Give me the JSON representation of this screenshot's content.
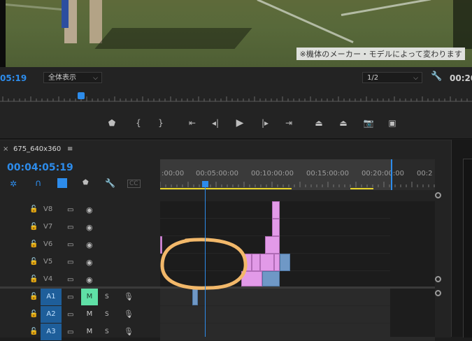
{
  "program_monitor": {
    "watermark": "※機体のメーカー・モデルによって変わります",
    "timecode_left": "05:19",
    "fit_select": "全体表示",
    "resolution_select": "1/2",
    "timecode_right": "00:20"
  },
  "transport": {
    "buttons": [
      "add-marker-icon",
      "mark-in-icon",
      "mark-out-icon",
      "go-to-in-icon",
      "step-back-icon",
      "play-icon",
      "step-forward-icon",
      "go-to-out-icon",
      "lift-icon",
      "extract-icon",
      "export-frame-icon",
      "comparison-view-icon"
    ]
  },
  "timeline": {
    "tab_label": "675_640x360",
    "tab_menu": "≡",
    "close": "×",
    "timecode": "00:04:05:19",
    "ruler_labels": [
      ":00:00",
      "00:05:00:00",
      "00:10:00:00",
      "00:15:00:00",
      "00:20:00:00",
      "00:2"
    ],
    "video_tracks": [
      {
        "name": "V8"
      },
      {
        "name": "V7"
      },
      {
        "name": "V6"
      },
      {
        "name": "V5"
      },
      {
        "name": "V4"
      }
    ],
    "audio_tracks": [
      {
        "name": "A1",
        "mute": "M",
        "solo": "S",
        "mute_active": true
      },
      {
        "name": "A2",
        "mute": "M",
        "solo": "S",
        "mute_active": false
      },
      {
        "name": "A3",
        "mute": "M",
        "solo": "S",
        "mute_active": false
      }
    ]
  },
  "colors": {
    "accent_blue": "#2d8ceb",
    "track_target_blue": "#1e5e9a",
    "mute_active": "#5fe0a6",
    "video_clip_pink": "#e29ae8",
    "clip_blue": "#6f98c6",
    "annotation_orange": "#f2b86a",
    "work_area_yellow": "#e6d22a"
  }
}
